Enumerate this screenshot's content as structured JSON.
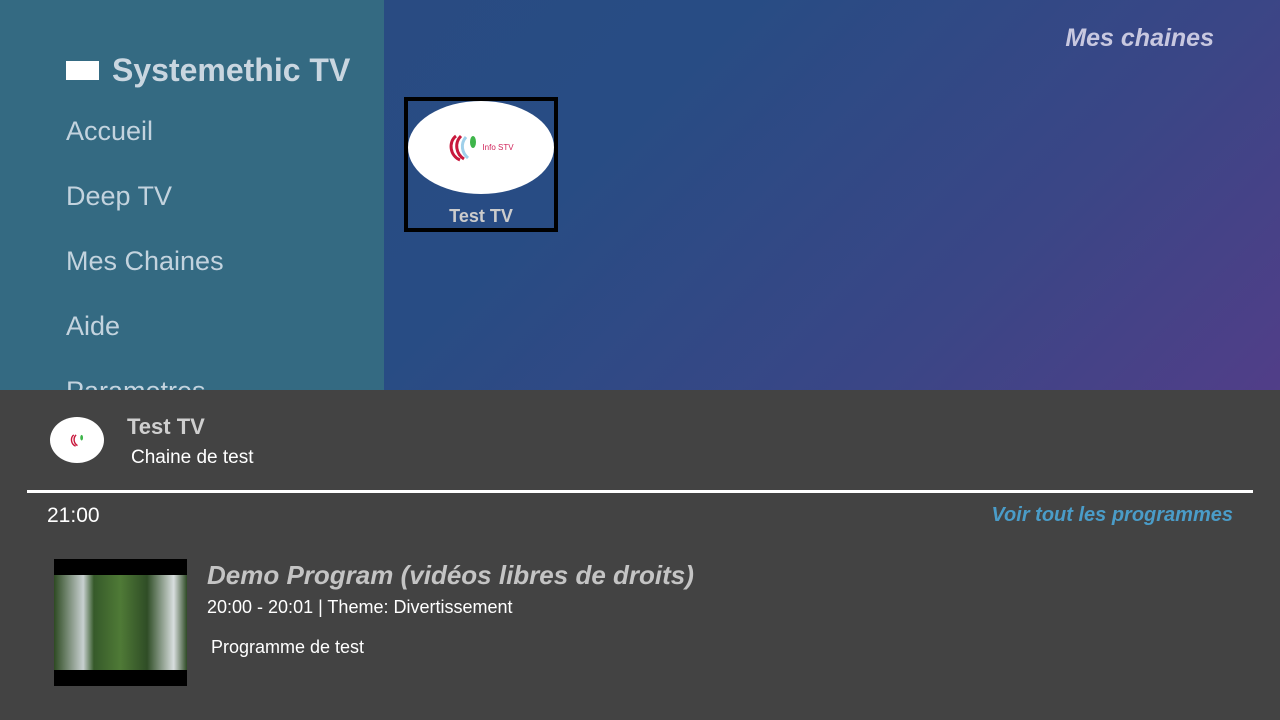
{
  "app": {
    "title": "Systemethic TV",
    "logo_text": "Systemethic TV"
  },
  "sidebar": {
    "items": [
      {
        "label": "Accueil"
      },
      {
        "label": "Deep TV"
      },
      {
        "label": "Mes Chaines"
      },
      {
        "label": "Aide"
      },
      {
        "label": "Parametres"
      }
    ]
  },
  "header": {
    "title": "Mes chaines"
  },
  "channels": [
    {
      "name": "Test TV",
      "logo_text": "Info STV"
    }
  ],
  "details": {
    "channel_name": "Test TV",
    "channel_description": "Chaine de test",
    "current_time": "21:00",
    "see_all_label": "Voir tout les programmes",
    "program": {
      "title": "Demo Program (vidéos libres de droits)",
      "meta": "20:00 - 20:01 | Theme: Divertissement",
      "description": "Programme de test"
    }
  },
  "colors": {
    "sidebar": "#346a82",
    "panel": "#434343",
    "link": "#4a9cc8"
  }
}
